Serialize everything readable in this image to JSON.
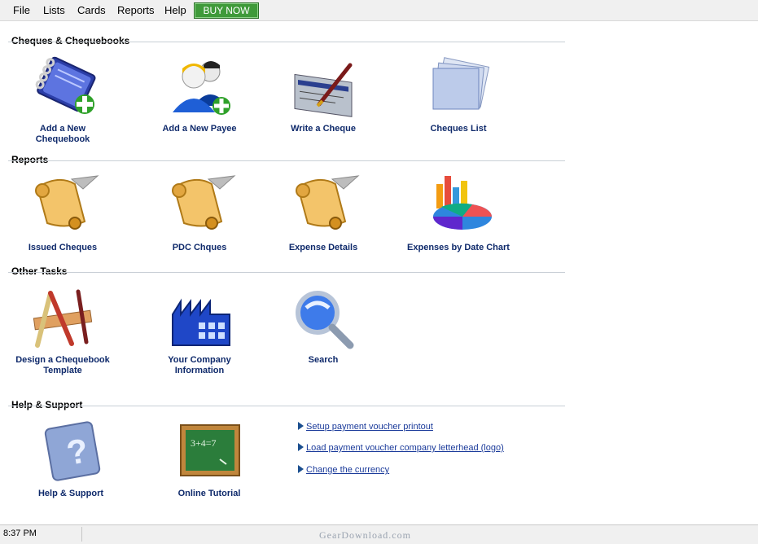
{
  "menu": {
    "file": "File",
    "lists": "Lists",
    "cards": "Cards",
    "reports": "Reports",
    "help": "Help",
    "buy_now": "BUY NOW"
  },
  "sections": {
    "cheques": {
      "title": "Cheques & Chequebooks",
      "tiles": [
        {
          "label": "Add a New\nChequebook",
          "icon": "chequebook-add-icon"
        },
        {
          "label": "Add a New Payee",
          "icon": "payee-add-icon"
        },
        {
          "label": "Write a Cheque",
          "icon": "write-cheque-icon"
        },
        {
          "label": "Cheques List",
          "icon": "cheques-list-icon"
        }
      ]
    },
    "reports": {
      "title": "Reports",
      "tiles": [
        {
          "label": "Issued Cheques",
          "icon": "scroll-report-icon"
        },
        {
          "label": "PDC Chques",
          "icon": "scroll-report-icon"
        },
        {
          "label": "Expense Details",
          "icon": "scroll-report-icon"
        },
        {
          "label": "Expenses by Date Chart",
          "icon": "pie-chart-icon"
        }
      ]
    },
    "other": {
      "title": "Other Tasks",
      "tiles": [
        {
          "label": "Design a Chequebook\nTemplate",
          "icon": "design-tools-icon"
        },
        {
          "label": "Your Company\nInformation",
          "icon": "factory-icon"
        },
        {
          "label": "Search",
          "icon": "magnifier-icon"
        }
      ]
    },
    "help": {
      "title": "Help & Support",
      "tiles": [
        {
          "label": "Help & Support",
          "icon": "help-book-icon"
        },
        {
          "label": "Online Tutorial",
          "icon": "chalkboard-icon"
        }
      ],
      "links": [
        "Setup payment voucher printout",
        "Load payment voucher company letterhead (logo)",
        "Change the currency"
      ]
    }
  },
  "status": {
    "time": "8:37 PM"
  },
  "watermark": "GearDownload.com"
}
